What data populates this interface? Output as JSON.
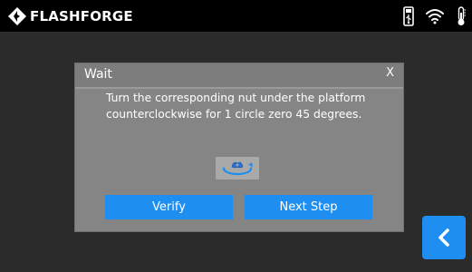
{
  "header": {
    "brand": "FLASHFORGE",
    "logo_icon": "flashforge-logo-icon",
    "status_icons": [
      "usb-icon",
      "wifi-icon",
      "thermometer-icon"
    ]
  },
  "dialog": {
    "title": "Wait",
    "close_label": "X",
    "message": "Turn the corresponding nut under the platform counterclockwise for 1 circle zero 45 degrees.",
    "illustration_icon": "rotate-counterclockwise-icon",
    "verify_label": "Verify",
    "next_label": "Next Step"
  },
  "navigation": {
    "back_icon": "chevron-left-icon"
  },
  "colors": {
    "accent": "#1e8ef0",
    "dialog_bg": "#858585",
    "screen_bg": "#2b2b2b",
    "topbar_bg": "#000000"
  }
}
